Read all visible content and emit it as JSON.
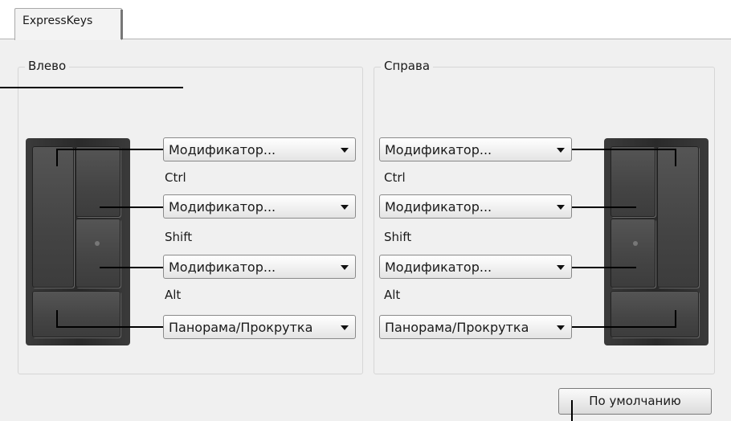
{
  "tab": {
    "label": "ExpressKeys"
  },
  "left_group": {
    "title": "Влево",
    "dropdowns": [
      {
        "value": "Модификатор...",
        "label": "Ctrl"
      },
      {
        "value": "Модификатор...",
        "label": "Shift"
      },
      {
        "value": "Модификатор...",
        "label": "Alt"
      },
      {
        "value": "Панорама/Прокрутка"
      }
    ]
  },
  "right_group": {
    "title": "Справа",
    "dropdowns": [
      {
        "value": "Модификатор...",
        "label": "Ctrl"
      },
      {
        "value": "Модификатор...",
        "label": "Shift"
      },
      {
        "value": "Модификатор...",
        "label": "Alt"
      },
      {
        "value": "Панорама/Прокрутка"
      }
    ]
  },
  "default_button": {
    "label": "По умолчанию"
  }
}
